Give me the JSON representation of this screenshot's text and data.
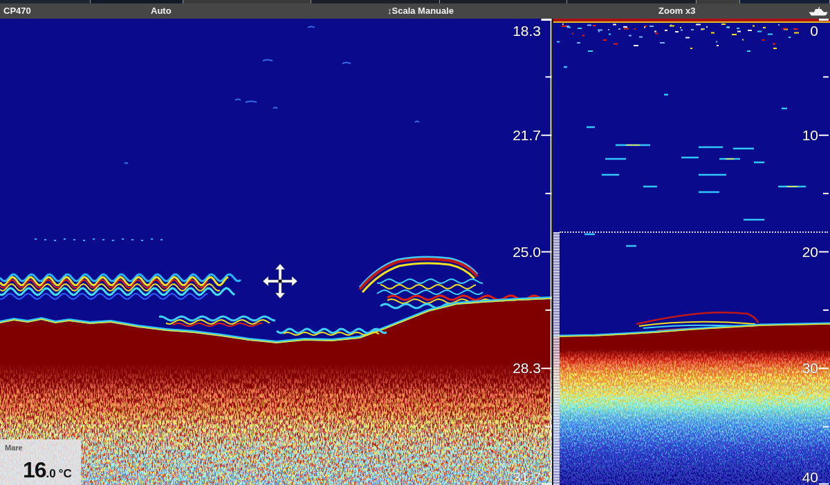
{
  "header": {
    "device": "CP470",
    "mode": "Auto",
    "range": "↕Scala Manuale",
    "zoom": "Zoom x3"
  },
  "sonar_view": {
    "depth_scale": [
      "18.3",
      "21.7",
      "25.0",
      "28.3",
      "31.7"
    ]
  },
  "zoom_view": {
    "depth_scale": [
      "0",
      "10",
      "20",
      "30",
      "40"
    ]
  },
  "water_temperature": {
    "label": "Mare",
    "value": "16",
    "decimals": ".0",
    "unit": "°C"
  }
}
